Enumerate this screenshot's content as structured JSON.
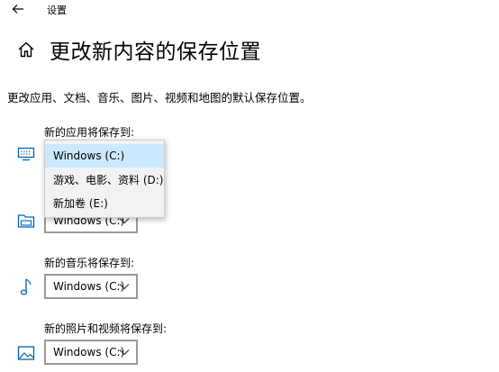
{
  "window": {
    "title": "设置"
  },
  "page": {
    "title": "更改新内容的保存位置",
    "description": "更改应用、文档、音乐、图片、视频和地图的默认保存位置。"
  },
  "sections": [
    {
      "label": "新的应用将保存到:",
      "icon": "monitor-icon",
      "value": "Windows (C:)"
    },
    {
      "label": "",
      "icon": "folder-icon",
      "value": "Windows (C:)"
    },
    {
      "label": "新的音乐将保存到:",
      "icon": "music-note-icon",
      "value": "Windows (C:)"
    },
    {
      "label": "新的照片和视频将保存到:",
      "icon": "picture-icon",
      "value": "Windows (C:)"
    }
  ],
  "dropdown": {
    "options": [
      "Windows (C:)",
      "游戏、电影、资料 (D:)",
      "新加卷 (E:)"
    ],
    "selected": "Windows (C:)"
  },
  "colors": {
    "accent": "#0078d7",
    "selected_bg": "#cce8ff",
    "border": "#999999"
  }
}
